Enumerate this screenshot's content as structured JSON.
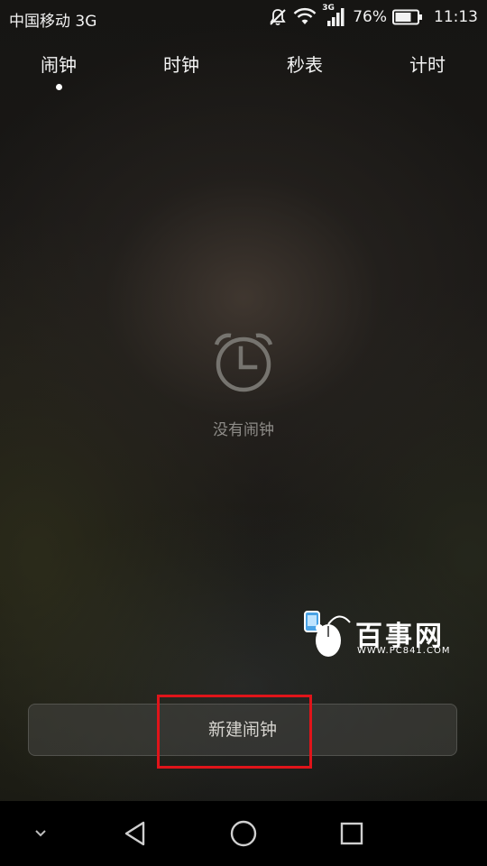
{
  "status_bar": {
    "carrier": "中国移动 3G",
    "network_badge": "3G",
    "battery_percent": "76%",
    "time": "11:13",
    "icons": [
      "mute-icon",
      "wifi-icon",
      "signal-icon",
      "battery-icon"
    ]
  },
  "tabs": [
    {
      "label": "闹钟",
      "selected": true
    },
    {
      "label": "时钟",
      "selected": false
    },
    {
      "label": "秒表",
      "selected": false
    },
    {
      "label": "计时",
      "selected": false
    }
  ],
  "empty_state": {
    "icon": "alarm-clock-icon",
    "text": "没有闹钟"
  },
  "watermark": {
    "title": "百事网",
    "subtitle": "WWW.PC841.COM"
  },
  "new_alarm_button": {
    "label": "新建闹钟"
  },
  "nav_bar": {
    "icons": [
      "collapse-chevron-icon",
      "back-icon",
      "home-icon",
      "recents-icon"
    ]
  },
  "colors": {
    "highlight_border": "#e0141a",
    "text_primary": "#f4f4f4",
    "text_muted": "#8e8c88"
  }
}
